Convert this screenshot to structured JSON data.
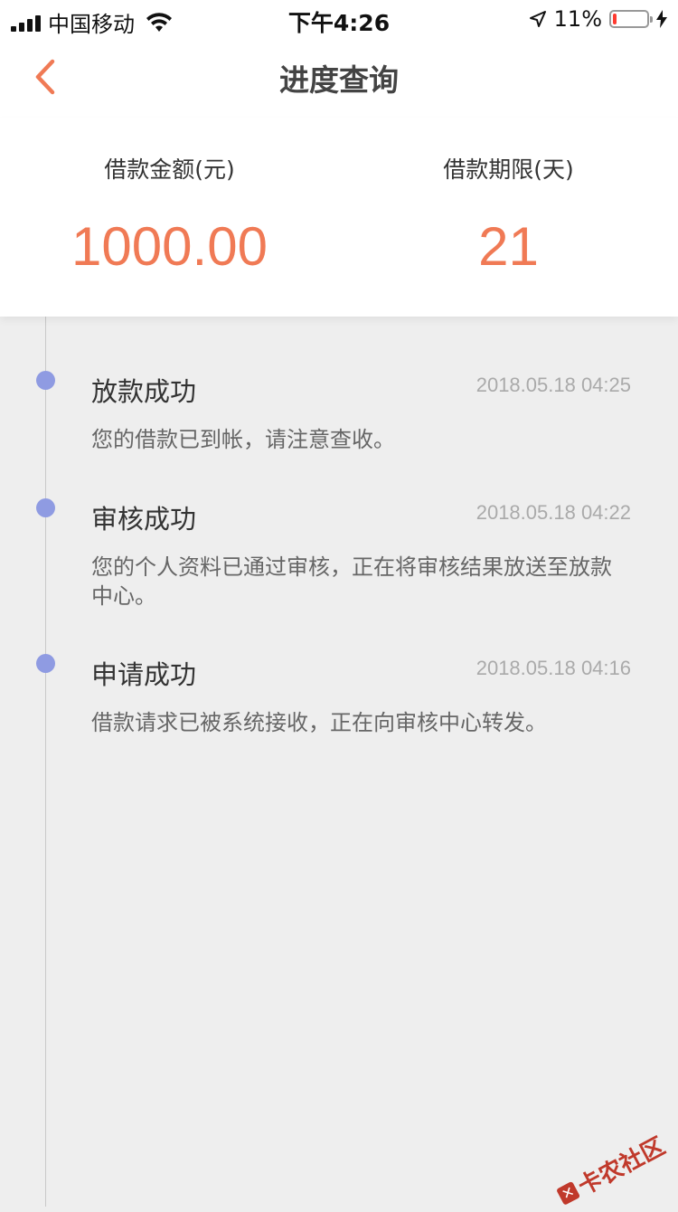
{
  "status_bar": {
    "carrier": "中国移动",
    "time": "下午4:26",
    "battery_percent": "11%",
    "battery_level": 0.11,
    "battery_color": "#ff3b30"
  },
  "nav": {
    "back_icon": "chevron-left-icon",
    "title": "进度查询",
    "accent_color": "#f07a55"
  },
  "summary": {
    "amount_label": "借款金额(元)",
    "amount_value": "1000.00",
    "term_label": "借款期限(天)",
    "term_value": "21"
  },
  "timeline": [
    {
      "title": "放款成功",
      "time": "2018.05.18 04:25",
      "desc": "您的借款已到帐，请注意查收。"
    },
    {
      "title": "审核成功",
      "time": "2018.05.18 04:22",
      "desc": "您的个人资料已通过审核，正在将审核结果放送至放款中心。"
    },
    {
      "title": "申请成功",
      "time": "2018.05.18 04:16",
      "desc": "借款请求已被系统接收，正在向审核中心转发。"
    }
  ],
  "watermark": {
    "text": "卡农社区"
  }
}
